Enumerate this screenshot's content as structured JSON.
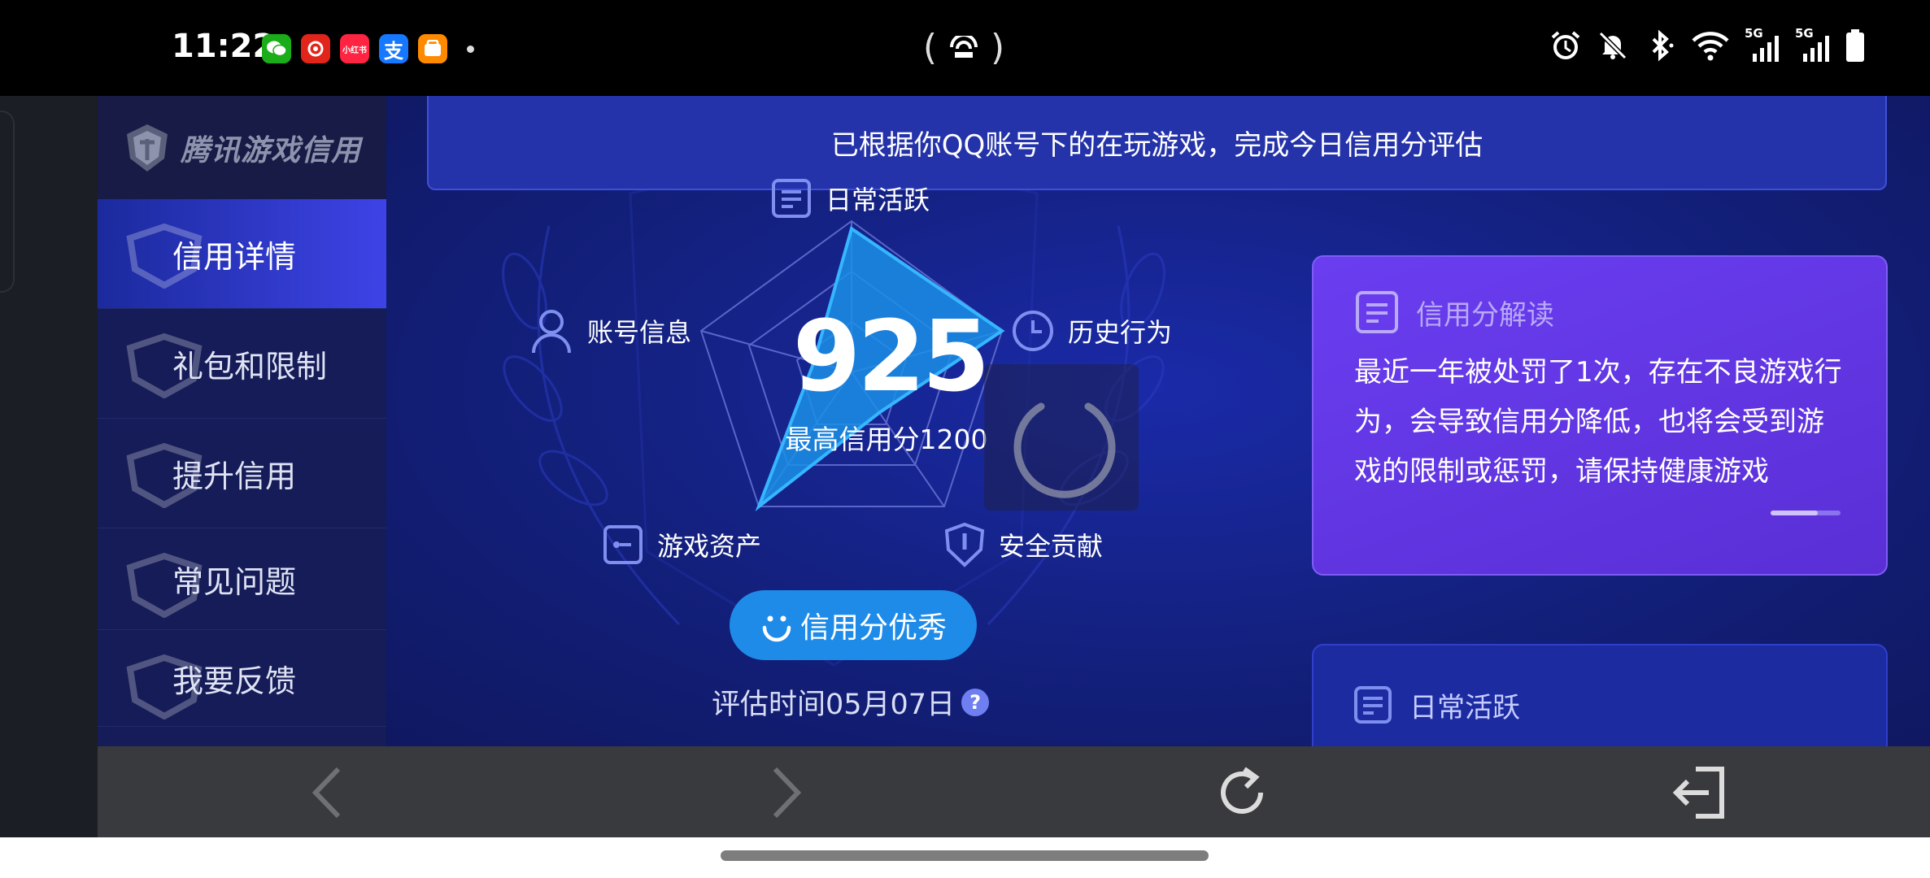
{
  "status_bar": {
    "time": "11:22",
    "apps": [
      {
        "name": "wechat-icon",
        "color": "#1aad19",
        "glyph": "W"
      },
      {
        "name": "app-red-icon",
        "color": "#e1251b",
        "glyph": "☷"
      },
      {
        "name": "xiaohongshu-icon",
        "color": "#ff2442",
        "glyph": "小红书"
      },
      {
        "name": "alipay-icon",
        "color": "#1677ff",
        "glyph": "支"
      },
      {
        "name": "taobao-icon",
        "color": "#ff8a00",
        "glyph": "▦"
      }
    ],
    "network_labels": [
      "5G",
      "5G"
    ]
  },
  "sidebar": {
    "brand": "腾讯游戏信用",
    "items": [
      {
        "label": "信用详情",
        "active": true
      },
      {
        "label": "礼包和限制",
        "active": false
      },
      {
        "label": "提升信用",
        "active": false
      },
      {
        "label": "常见问题",
        "active": false
      },
      {
        "label": "我要反馈",
        "active": false
      }
    ]
  },
  "banner": {
    "text": "已根据你QQ账号下的在玩游戏，完成今日信用分评估"
  },
  "radar": {
    "axes": [
      {
        "label": "日常活跃",
        "icon": "document-icon"
      },
      {
        "label": "历史行为",
        "icon": "clock-icon"
      },
      {
        "label": "安全贡献",
        "icon": "shield-icon"
      },
      {
        "label": "游戏资产",
        "icon": "wallet-icon"
      },
      {
        "label": "账号信息",
        "icon": "person-icon"
      }
    ],
    "values": [
      0.95,
      1.0,
      0.3,
      1.0,
      0.25
    ],
    "fill_color": "#1b8fe6"
  },
  "score": {
    "value": "925",
    "max_label": "最高信用分1200"
  },
  "grade": {
    "label": "信用分优秀"
  },
  "eval_time": {
    "label": "评估时间05月07日",
    "help": "?"
  },
  "interpretation": {
    "title": "信用分解读",
    "body": "最近一年被处罚了1次，存在不良游戏行为，会导致信用分降低，也将会受到游戏的限制或惩罚，请保持健康游戏"
  },
  "daily_card": {
    "title": "日常活跃"
  }
}
